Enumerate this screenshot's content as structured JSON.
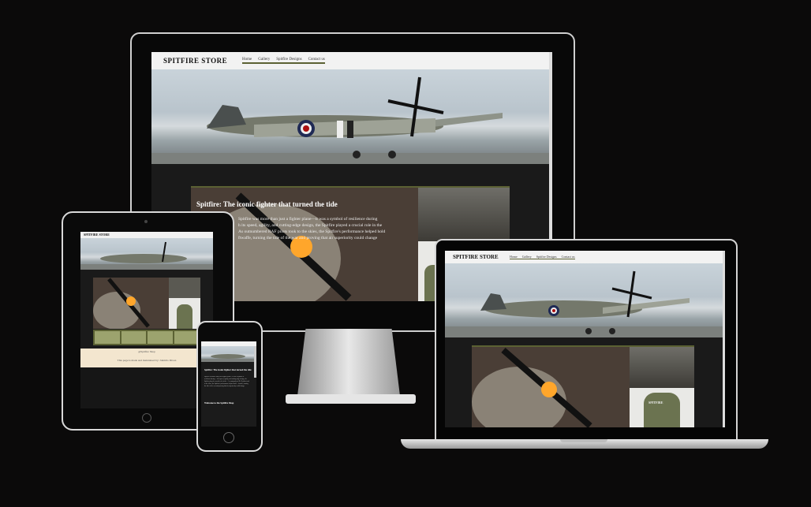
{
  "site": {
    "brand": "SPITFIRE STORE",
    "nav": [
      "Home",
      "Gallery",
      "Spitfire Designs",
      "Contact us"
    ],
    "hero_heading": "Spitfire: The iconic fighter that turned the tide",
    "hero_text": "Spitfire was more than just a fighter plane—it was a symbol of resilience during ... h its speed, agility, and cutting-edge design, the Spitfire played a crucial role in the ... As outnumbered RAF pilots took to the skies, the Spitfire's performance helped hold ... ftwaffe, turning the tide of the war and proving that air superiority could change",
    "hero_text_lines": [
      "Spitfire was more than just a fighter plane—it was a symbol of resilience during",
      "h its speed, agility, and cutting-edge design, the Spitfire played a crucial role in the",
      "As outnumbered RAF pilots took to the skies, the Spitfire's performance helped hold",
      "ftwaffe, turning the tide of the war and proving that air superiority could change"
    ],
    "footer_copyright": "@Spitfire Shop",
    "footer_credit": "This page is made and maintained by: Jahmilo Dixon",
    "welcome_heading": "Welcome to the Spitfire Shop",
    "hoodie_label": "SPITFIRE"
  },
  "colors": {
    "background": "#0b0a0a",
    "accent_olive": "#5b6133",
    "footer_cream": "#f3e6cf"
  }
}
